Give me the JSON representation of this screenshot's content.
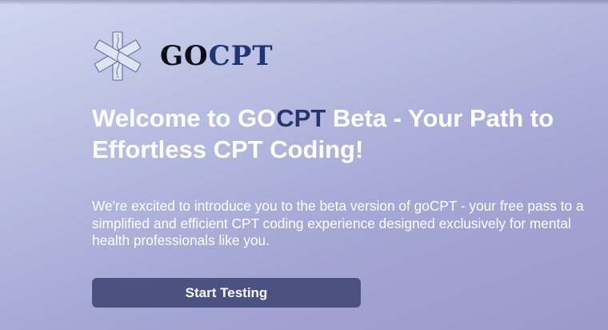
{
  "brand": {
    "logo_part1": "GO",
    "logo_part2": "CPT",
    "icon": "star-of-life-icon",
    "logo_text_color": "#0c0c14",
    "logo_accent_color": "#1f3573"
  },
  "hero": {
    "headline_part1": "Welcome to GO",
    "headline_accent": "CPT",
    "headline_part2": " Beta - Your Path to Effortless CPT Coding!",
    "intro": "We're excited to introduce you to the beta version of goCPT - your free pass to a simplified and efficient CPT coding experience designed exclusively for mental health professionals like you."
  },
  "actions": {
    "start_label": "Start Testing",
    "button_color": "#4b5181"
  }
}
